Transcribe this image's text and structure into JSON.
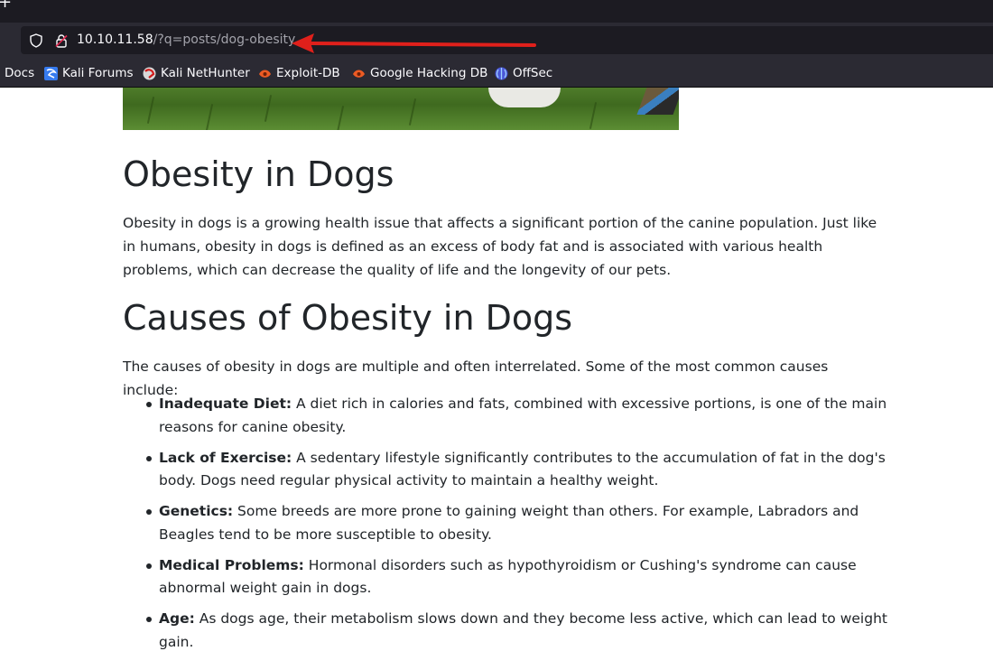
{
  "browser": {
    "url_host": "10.10.11.58",
    "url_path": "/?q=posts/dog-obesity",
    "arrow_color": "#e0201b",
    "new_tab_glyph": "+"
  },
  "bookmarks": [
    {
      "label": "Docs",
      "icon": "none"
    },
    {
      "label": "Kali Forums",
      "icon": "kali-forums-icon"
    },
    {
      "label": "Kali NetHunter",
      "icon": "kali-nethunter-icon"
    },
    {
      "label": "Exploit-DB",
      "icon": "exploit-db-icon"
    },
    {
      "label": "Google Hacking DB",
      "icon": "ghdb-icon"
    },
    {
      "label": "OffSec",
      "icon": "offsec-icon"
    }
  ],
  "article": {
    "title": "Obesity in Dogs",
    "intro": "Obesity in dogs is a growing health issue that affects a significant portion of the canine population. Just like in humans, obesity in dogs is defined as an excess of body fat and is associated with various health problems, which can decrease the quality of life and the longevity of our pets.",
    "causes_heading": "Causes of Obesity in Dogs",
    "causes_intro": "The causes of obesity in dogs are multiple and often interrelated. Some of the most common causes include:",
    "causes": [
      {
        "term": "Inadequate Diet:",
        "text": " A diet rich in calories and fats, combined with excessive portions, is one of the main reasons for canine obesity."
      },
      {
        "term": "Lack of Exercise:",
        "text": " A sedentary lifestyle significantly contributes to the accumulation of fat in the dog's body. Dogs need regular physical activity to maintain a healthy weight."
      },
      {
        "term": "Genetics:",
        "text": " Some breeds are more prone to gaining weight than others. For example, Labradors and Beagles tend to be more susceptible to obesity."
      },
      {
        "term": "Medical Problems:",
        "text": " Hormonal disorders such as hypothyroidism or Cushing's syndrome can cause abnormal weight gain in dogs."
      },
      {
        "term": "Age:",
        "text": " As dogs age, their metabolism slows down and they become less active, which can lead to weight gain."
      }
    ]
  }
}
